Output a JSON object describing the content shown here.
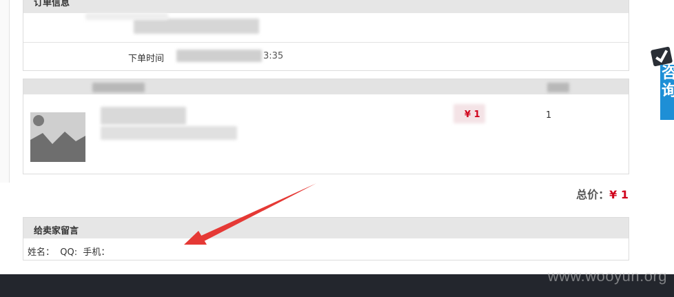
{
  "order_info": {
    "title": "订单信息",
    "order_time_label": "下单时间",
    "order_time_tail": "3:35"
  },
  "product": {
    "price": "¥ 1",
    "quantity": "1",
    "image_icon": "image-placeholder-icon"
  },
  "total": {
    "label": "总价：",
    "amount": "¥ 1"
  },
  "seller_message": {
    "title": "给卖家留言",
    "contact_line": "姓名：  QQ:  手机："
  },
  "consult": {
    "chars": [
      "咨",
      "询"
    ],
    "icon": "check-icon",
    "accent": "#1e8fd6"
  },
  "footer": {
    "watermark": "www.wooyun.org"
  },
  "colors": {
    "price_red": "#d0021b",
    "arrow_red": "#e53935",
    "footer_bg": "#23262d"
  }
}
